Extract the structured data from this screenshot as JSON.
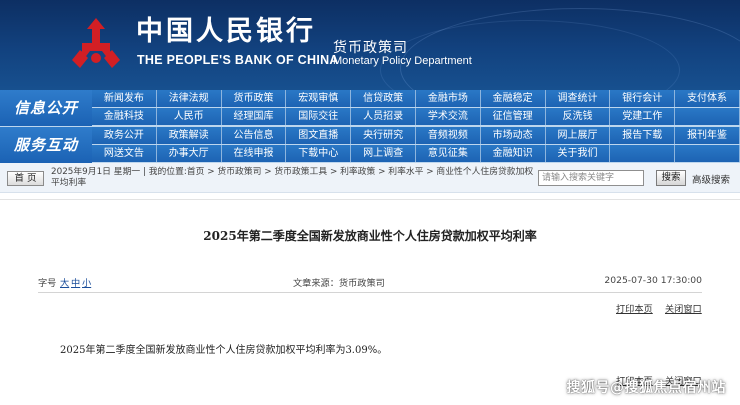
{
  "header": {
    "bank_name_cn": "中国人民银行",
    "bank_name_en": "THE PEOPLE'S BANK OF CHINA",
    "dept_cn": "货币政策司",
    "dept_en": "Monetary Policy Department",
    "logo_icon": "pboc-emblem-icon",
    "banner_color": "#12427f"
  },
  "nav": {
    "section1_label": "信息公开",
    "section2_label": "服务互动",
    "row1": [
      "新闻发布",
      "法律法规",
      "货币政策",
      "宏观审慎",
      "信贷政策",
      "金融市场",
      "金融稳定",
      "调查统计",
      "银行会计",
      "支付体系"
    ],
    "row2": [
      "金融科技",
      "人民币",
      "经理国库",
      "国际交往",
      "人员招录",
      "学术交流",
      "征信管理",
      "反洗钱",
      "党建工作",
      ""
    ],
    "row3": [
      "政务公开",
      "政策解读",
      "公告信息",
      "图文直播",
      "央行研究",
      "音频视频",
      "市场动态",
      "网上展厅",
      "报告下载",
      "报刊年鉴"
    ],
    "row4": [
      "网送文告",
      "办事大厅",
      "在线申报",
      "下载中心",
      "网上调查",
      "意见征集",
      "金融知识",
      "关于我们",
      "",
      ""
    ]
  },
  "toolbar": {
    "home_label": "首 页",
    "breadcrumb": "2025年9月1日 星期一 | 我的位置:首页 > 货币政策司 > 货币政策工具 > 利率政策 > 利率水平 > 商业性个人住房贷款加权平均利率",
    "search_placeholder": "请输入搜索关键字",
    "search_button": "搜索",
    "advanced_search": "高级搜索"
  },
  "article": {
    "title": "2025年第二季度全国新发放商业性个人住房贷款加权平均利率",
    "font_size_label": "字号",
    "font_sizes": [
      "大",
      "中",
      "小"
    ],
    "source": "文章来源：货币政策司",
    "date": "2025-07-30 17:30:00",
    "print_label": "打印本页",
    "close_label": "关闭窗口",
    "body": "2025年第二季度全国新发放商业性个人住房贷款加权平均利率为3.09%。"
  },
  "watermark": "搜狐号@搜狐焦点宿州站"
}
